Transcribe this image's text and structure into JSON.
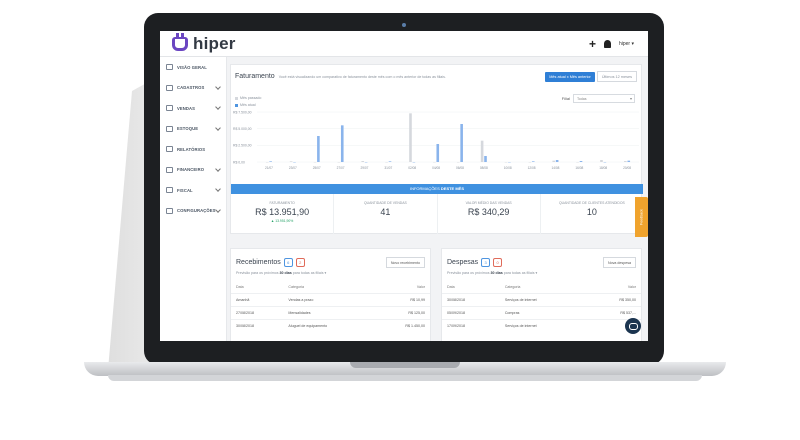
{
  "app": {
    "logo_text": "hiper",
    "user_menu": "hiper ▾"
  },
  "sidebar": {
    "items": [
      {
        "label": "VISÃO GERAL",
        "icon": "dashboard-icon",
        "has_chevron": false
      },
      {
        "label": "CADASTROS",
        "icon": "register-icon",
        "has_chevron": true
      },
      {
        "label": "VENDAS",
        "icon": "cart-icon",
        "has_chevron": true
      },
      {
        "label": "ESTOQUE",
        "icon": "box-icon",
        "has_chevron": true
      },
      {
        "label": "RELATÓRIOS",
        "icon": "report-icon",
        "has_chevron": false
      },
      {
        "label": "FINANCEIRO",
        "icon": "money-icon",
        "has_chevron": true
      },
      {
        "label": "FISCAL",
        "icon": "document-icon",
        "has_chevron": true
      },
      {
        "label": "CONFIGURAÇÕES",
        "icon": "gear-icon",
        "has_chevron": true
      }
    ]
  },
  "faturamento": {
    "title": "Faturamento",
    "subtitle": "Você está visualizando um comparativo de faturamento deste mês com o mês anterior de todas as filiais.",
    "btn_active": "Mês atual x Mês anterior",
    "btn_inactive": "Últimos 12 meses",
    "legend_prev": "Mês passado",
    "legend_curr": "Mês atual",
    "filial_label": "Filial",
    "filial_value": "Todas"
  },
  "chart_data": {
    "type": "bar",
    "ylabels": [
      "R$ 7.500,00",
      "R$ 5.000,00",
      "R$ 2.500,00",
      "R$ 0,00"
    ],
    "ylim": [
      0,
      7500
    ],
    "categories": [
      "21/07",
      "23/07",
      "25/07",
      "27/07",
      "29/07",
      "31/07",
      "02/08",
      "04/08",
      "06/08",
      "08/08",
      "10/08",
      "12/08",
      "14/08",
      "16/08",
      "18/08",
      "20/08"
    ],
    "series": [
      {
        "name": "Mês passado",
        "color": "#d5d8dd",
        "values": [
          0,
          100,
          0,
          0,
          150,
          0,
          7300,
          0,
          0,
          3200,
          0,
          0,
          200,
          0,
          300,
          150
        ]
      },
      {
        "name": "Mês atual",
        "color": "#8ab4ec",
        "values": [
          100,
          0,
          3900,
          5500,
          0,
          100,
          0,
          2700,
          5700,
          900,
          0,
          100,
          300,
          150,
          0,
          200
        ]
      }
    ]
  },
  "info_bar": {
    "prefix": "INFORMAÇÕES",
    "strong": "DESTE MÊS"
  },
  "kpis": [
    {
      "label": "FATURAMENTO",
      "value": "R$ 13.951,90",
      "delta": "▲ 13.951,90%"
    },
    {
      "label": "QUANTIDADE DE VENDAS",
      "value": "41",
      "delta": ""
    },
    {
      "label": "VALOR MÉDIO DAS VENDAS",
      "value": "R$ 340,29",
      "delta": ""
    },
    {
      "label": "QUANTIDADE DE CLIENTES ATENDIDOS",
      "value": "10",
      "delta": ""
    }
  ],
  "feedback_tab": "Feedback",
  "recebimentos": {
    "title": "Recebimentos",
    "count_blue": "6",
    "count_red": "2",
    "button": "Novo recebimento",
    "hint_pre": "Previsão para os próximos",
    "hint_bold": "30 dias",
    "hint_post": "para todas as filiais ▾",
    "headers": [
      "Data",
      "Categoria",
      "Valor"
    ],
    "rows": [
      [
        "Amanhã",
        "Vendas a prazo",
        "R$ 10,99"
      ],
      [
        "27/08/2018",
        "Mensalidades",
        "R$ 125,00"
      ],
      [
        "30/08/2018",
        "Aluguel de equipamento",
        "R$ 1.450,00"
      ]
    ]
  },
  "despesas": {
    "title": "Despesas",
    "count_blue": "3",
    "count_red": "0",
    "button": "Nova despesa",
    "hint_pre": "Previsão para os próximos",
    "hint_bold": "30 dias",
    "hint_post": "para todas as filiais ▾",
    "headers": [
      "Data",
      "Categoria",
      "Valor"
    ],
    "rows": [
      [
        "30/08/2018",
        "Serviços de internet",
        "R$ 350,00"
      ],
      [
        "05/09/2018",
        "Compras",
        "R$ 537,..."
      ],
      [
        "17/09/2018",
        "Serviços de internet",
        "R$ 3..."
      ]
    ]
  }
}
